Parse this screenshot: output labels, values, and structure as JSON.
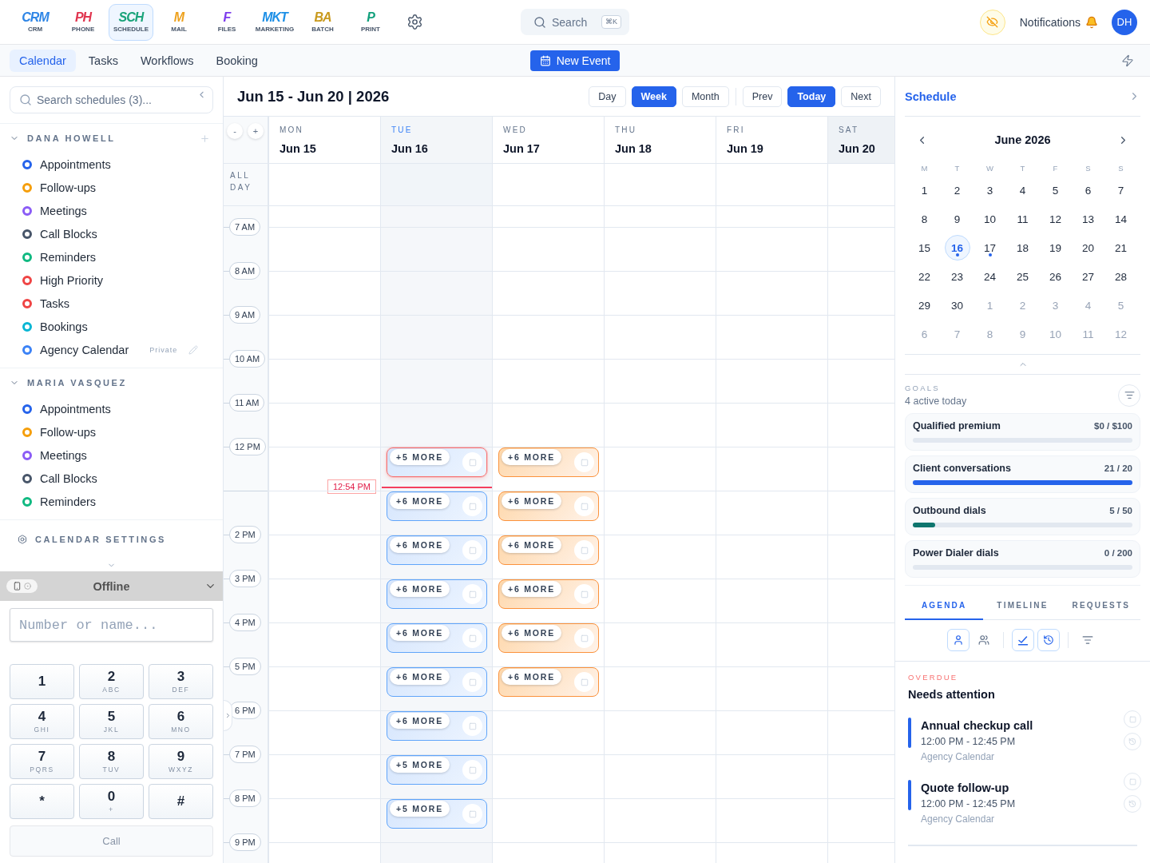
{
  "top_bar": {
    "apps": [
      {
        "mark": "CRM",
        "label": "CRM",
        "color": "#2f86e6",
        "selected": false
      },
      {
        "mark": "PH",
        "label": "PHONE",
        "color": "#e0344e",
        "selected": false
      },
      {
        "mark": "SCH",
        "label": "SCHEDULE",
        "color": "#1aa37a",
        "selected": true
      },
      {
        "mark": "M",
        "label": "MAIL",
        "color": "#eea21f",
        "selected": false
      },
      {
        "mark": "F",
        "label": "FILES",
        "color": "#7c3aed",
        "selected": false
      },
      {
        "mark": "MKT",
        "label": "MARKETING",
        "color": "#1d8fe6",
        "selected": false
      },
      {
        "mark": "BA",
        "label": "BATCH",
        "color": "#c99a1e",
        "selected": false
      },
      {
        "mark": "P",
        "label": "PRINT",
        "color": "#12a07c",
        "selected": false
      }
    ],
    "search": {
      "label": "Search",
      "shortcut": "⌘K"
    },
    "notifications": {
      "label": "Notifications"
    },
    "avatar": {
      "initials": "DH"
    }
  },
  "sub_nav": {
    "tabs": [
      {
        "label": "Calendar",
        "selected": true
      },
      {
        "label": "Tasks",
        "selected": false
      },
      {
        "label": "Workflows",
        "selected": false
      },
      {
        "label": "Booking",
        "selected": false
      }
    ],
    "new_event": "New Event"
  },
  "sidebar": {
    "search": {
      "placeholder": "Search schedules (3)..."
    },
    "groups": [
      {
        "name": "DANA HOWELL",
        "expanded": true,
        "can_add": true,
        "calendars": [
          {
            "name": "Appointments",
            "color": "#2563eb",
            "editable": false
          },
          {
            "name": "Follow-ups",
            "color": "#f59e0b",
            "editable": false
          },
          {
            "name": "Meetings",
            "color": "#8b5cf6",
            "editable": false
          },
          {
            "name": "Call Blocks",
            "color": "#475569",
            "editable": false
          },
          {
            "name": "Reminders",
            "color": "#10b981",
            "editable": false
          },
          {
            "name": "High Priority",
            "color": "#ef4444",
            "editable": false
          },
          {
            "name": "Tasks",
            "color": "#ef4444",
            "editable": false
          },
          {
            "name": "Bookings",
            "color": "#06b6d4",
            "editable": false
          },
          {
            "name": "Agency Calendar",
            "color": "#3b82f6",
            "badge": "Private",
            "editable": true
          }
        ]
      },
      {
        "name": "MARIA VASQUEZ",
        "expanded": true,
        "can_add": false,
        "calendars": [
          {
            "name": "Appointments",
            "color": "#2563eb",
            "editable": false
          },
          {
            "name": "Follow-ups",
            "color": "#f59e0b",
            "editable": false
          },
          {
            "name": "Meetings",
            "color": "#8b5cf6",
            "editable": false
          },
          {
            "name": "Call Blocks",
            "color": "#475569",
            "editable": false
          },
          {
            "name": "Reminders",
            "color": "#10b981",
            "editable": false
          }
        ]
      }
    ],
    "settings_label": "CALENDAR SETTINGS"
  },
  "dialer": {
    "status": "Offline",
    "placeholder": "Number or name...",
    "keys": [
      {
        "digit": "1"
      },
      {
        "digit": "2",
        "letters": "ABC"
      },
      {
        "digit": "3",
        "letters": "DEF"
      },
      {
        "digit": "4",
        "letters": "GHI"
      },
      {
        "digit": "5",
        "letters": "JKL"
      },
      {
        "digit": "6",
        "letters": "MNO"
      },
      {
        "digit": "7",
        "letters": "PQRS"
      },
      {
        "digit": "8",
        "letters": "TUV"
      },
      {
        "digit": "9",
        "letters": "WXYZ"
      },
      {
        "digit": "*"
      },
      {
        "digit": "0",
        "letters": "+"
      },
      {
        "digit": "#"
      }
    ],
    "call": {
      "label": "Call",
      "disabled": true
    }
  },
  "calendar": {
    "title": "Jun 15 - Jun 20 | 2026",
    "views": [
      {
        "label": "Day",
        "selected": false
      },
      {
        "label": "Week",
        "selected": true
      },
      {
        "label": "Month",
        "selected": false
      }
    ],
    "nav": [
      {
        "label": "Prev",
        "selected": false
      },
      {
        "label": "Today",
        "selected": true
      },
      {
        "label": "Next",
        "selected": false
      }
    ],
    "zoom_buttons": [
      "-",
      "+"
    ],
    "all_day_label": "ALL DAY",
    "hours": [
      {
        "kind": "label",
        "label": "7 AM"
      },
      {
        "kind": "label",
        "label": "8 AM"
      },
      {
        "kind": "label",
        "label": "9 AM"
      },
      {
        "kind": "label",
        "label": "10 AM"
      },
      {
        "kind": "label",
        "label": "11 AM"
      },
      {
        "kind": "label",
        "label": "12 PM"
      },
      {
        "kind": "rule"
      },
      {
        "kind": "label",
        "label": "2 PM"
      },
      {
        "kind": "label",
        "label": "3 PM"
      },
      {
        "kind": "label",
        "label": "4 PM"
      },
      {
        "kind": "label",
        "label": "5 PM"
      },
      {
        "kind": "label",
        "label": "6 PM"
      },
      {
        "kind": "label",
        "label": "7 PM"
      },
      {
        "kind": "label",
        "label": "8 PM"
      },
      {
        "kind": "label",
        "label": "9 PM"
      }
    ],
    "now": {
      "label": "12:54 PM"
    },
    "days": [
      {
        "weekday": "MON",
        "date": "Jun 15",
        "today": false,
        "weekend": false
      },
      {
        "weekday": "TUE",
        "date": "Jun 16",
        "today": true,
        "weekend": false,
        "events": [
          {
            "kind": "appointment",
            "overdue": true,
            "more": "+5 MORE"
          },
          {
            "kind": "appointment",
            "overdue": false,
            "more": "+6 MORE"
          },
          {
            "kind": "appointment",
            "overdue": false,
            "more": "+6 MORE"
          },
          {
            "kind": "appointment",
            "overdue": false,
            "more": "+6 MORE"
          },
          {
            "kind": "appointment",
            "overdue": false,
            "more": "+6 MORE"
          },
          {
            "kind": "appointment",
            "overdue": false,
            "more": "+6 MORE"
          },
          {
            "kind": "appointment",
            "overdue": false,
            "more": "+6 MORE"
          },
          {
            "kind": "appointment",
            "overdue": false,
            "more": "+5 MORE"
          },
          {
            "kind": "appointment",
            "overdue": false,
            "more": "+5 MORE"
          }
        ]
      },
      {
        "weekday": "WED",
        "date": "Jun 17",
        "today": false,
        "weekend": false,
        "events": [
          {
            "kind": "follow-up",
            "overdue": false,
            "more": "+6 MORE"
          },
          {
            "kind": "follow-up",
            "overdue": false,
            "more": "+6 MORE"
          },
          {
            "kind": "follow-up",
            "overdue": false,
            "more": "+6 MORE"
          },
          {
            "kind": "follow-up",
            "overdue": false,
            "more": "+6 MORE"
          },
          {
            "kind": "follow-up",
            "overdue": false,
            "more": "+6 MORE"
          },
          {
            "kind": "follow-up",
            "overdue": false,
            "more": "+6 MORE"
          }
        ]
      },
      {
        "weekday": "THU",
        "date": "Jun 18",
        "today": false,
        "weekend": false
      },
      {
        "weekday": "FRI",
        "date": "Jun 19",
        "today": false,
        "weekend": false
      },
      {
        "weekday": "SAT",
        "date": "Jun 20",
        "today": false,
        "weekend": true
      }
    ]
  },
  "schedule": {
    "title": "Schedule",
    "month": "June 2026",
    "weekdays": [
      "M",
      "T",
      "W",
      "T",
      "F",
      "S",
      "S"
    ],
    "days": [
      {
        "label": "1",
        "selected": false,
        "muted": false,
        "dot": false
      },
      {
        "label": "2",
        "selected": false,
        "muted": false,
        "dot": false
      },
      {
        "label": "3",
        "selected": false,
        "muted": false,
        "dot": false
      },
      {
        "label": "4",
        "selected": false,
        "muted": false,
        "dot": false
      },
      {
        "label": "5",
        "selected": false,
        "muted": false,
        "dot": false
      },
      {
        "label": "6",
        "selected": false,
        "muted": false,
        "dot": false
      },
      {
        "label": "7",
        "selected": false,
        "muted": false,
        "dot": false
      },
      {
        "label": "8",
        "selected": false,
        "muted": false,
        "dot": false
      },
      {
        "label": "9",
        "selected": false,
        "muted": false,
        "dot": false
      },
      {
        "label": "10",
        "selected": false,
        "muted": false,
        "dot": false
      },
      {
        "label": "11",
        "selected": false,
        "muted": false,
        "dot": false
      },
      {
        "label": "12",
        "selected": false,
        "muted": false,
        "dot": false
      },
      {
        "label": "13",
        "selected": false,
        "muted": false,
        "dot": false
      },
      {
        "label": "14",
        "selected": false,
        "muted": false,
        "dot": false
      },
      {
        "label": "15",
        "selected": false,
        "muted": false,
        "dot": false
      },
      {
        "label": "16",
        "selected": true,
        "muted": false,
        "dot": true
      },
      {
        "label": "17",
        "selected": false,
        "muted": false,
        "dot": true
      },
      {
        "label": "18",
        "selected": false,
        "muted": false,
        "dot": false
      },
      {
        "label": "19",
        "selected": false,
        "muted": false,
        "dot": false
      },
      {
        "label": "20",
        "selected": false,
        "muted": false,
        "dot": false
      },
      {
        "label": "21",
        "selected": false,
        "muted": false,
        "dot": false
      },
      {
        "label": "22",
        "selected": false,
        "muted": false,
        "dot": false
      },
      {
        "label": "23",
        "selected": false,
        "muted": false,
        "dot": false
      },
      {
        "label": "24",
        "selected": false,
        "muted": false,
        "dot": false
      },
      {
        "label": "25",
        "selected": false,
        "muted": false,
        "dot": false
      },
      {
        "label": "26",
        "selected": false,
        "muted": false,
        "dot": false
      },
      {
        "label": "27",
        "selected": false,
        "muted": false,
        "dot": false
      },
      {
        "label": "28",
        "selected": false,
        "muted": false,
        "dot": false
      },
      {
        "label": "29",
        "selected": false,
        "muted": false,
        "dot": false
      },
      {
        "label": "30",
        "selected": false,
        "muted": false,
        "dot": false
      },
      {
        "label": "1",
        "selected": false,
        "muted": true,
        "dot": false
      },
      {
        "label": "2",
        "selected": false,
        "muted": true,
        "dot": false
      },
      {
        "label": "3",
        "selected": false,
        "muted": true,
        "dot": false
      },
      {
        "label": "4",
        "selected": false,
        "muted": true,
        "dot": false
      },
      {
        "label": "5",
        "selected": false,
        "muted": true,
        "dot": false
      },
      {
        "label": "6",
        "selected": false,
        "muted": true,
        "dot": false
      },
      {
        "label": "7",
        "selected": false,
        "muted": true,
        "dot": false
      },
      {
        "label": "8",
        "selected": false,
        "muted": true,
        "dot": false
      },
      {
        "label": "9",
        "selected": false,
        "muted": true,
        "dot": false
      },
      {
        "label": "10",
        "selected": false,
        "muted": true,
        "dot": false
      },
      {
        "label": "11",
        "selected": false,
        "muted": true,
        "dot": false
      },
      {
        "label": "12",
        "selected": false,
        "muted": true,
        "dot": false
      }
    ],
    "goals": {
      "label": "GOALS",
      "summary": "4 active today",
      "items": [
        {
          "name": "Qualified premium",
          "value": "$0 / $100"
        },
        {
          "name": "Client conversations",
          "value": "21 / 20",
          "level": 1,
          "color": "#2563eb"
        },
        {
          "name": "Outbound dials",
          "value": "5 / 50",
          "level": 0.1,
          "color": "#0f766e"
        },
        {
          "name": "Power Dialer dials",
          "value": "0 / 200"
        }
      ]
    },
    "tabs": [
      {
        "label": "AGENDA",
        "selected": true
      },
      {
        "label": "TIMELINE",
        "selected": false
      },
      {
        "label": "REQUESTS",
        "selected": false
      }
    ],
    "view_toggles": [
      {
        "selected": true
      },
      {
        "selected": false
      }
    ],
    "status_toggles": [
      {
        "selected": true
      },
      {
        "selected": true
      }
    ],
    "overdue": {
      "label": "OVERDUE",
      "title": "Needs attention",
      "items": [
        {
          "title": "Annual checkup call",
          "time": "12:00 PM - 12:45 PM",
          "calendar": "Agency Calendar"
        },
        {
          "title": "Quote follow-up",
          "time": "12:00 PM - 12:45 PM",
          "calendar": "Agency Calendar"
        }
      ]
    }
  }
}
